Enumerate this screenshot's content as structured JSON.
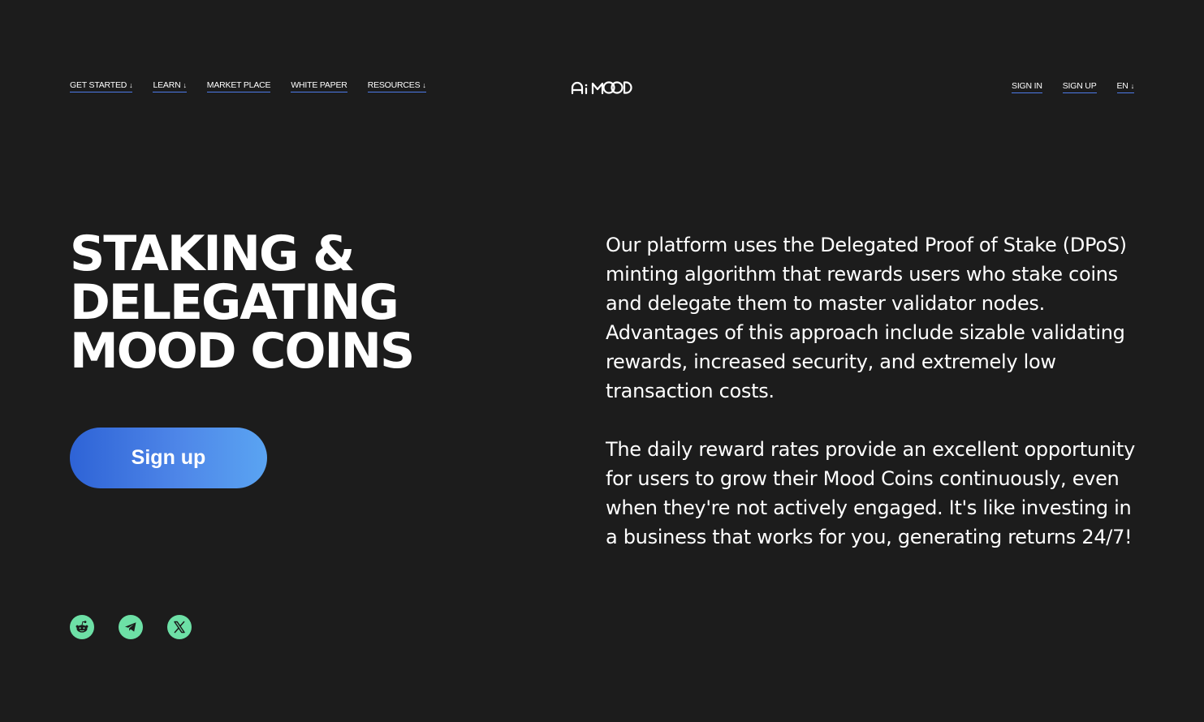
{
  "header": {
    "nav_left": [
      {
        "label": "GET STARTED",
        "dropdown": true
      },
      {
        "label": "LEARN",
        "dropdown": true
      },
      {
        "label": "MARKET PLACE",
        "dropdown": false
      },
      {
        "label": "WHITE PAPER",
        "dropdown": false
      },
      {
        "label": "RESOURCES",
        "dropdown": true
      }
    ],
    "logo_text": "Ai MOOD",
    "sign_in": "SIGN IN",
    "sign_up": "SIGN UP",
    "language": "EN",
    "dropdown_arrow": "↓"
  },
  "hero": {
    "title_lines": [
      "STAKING &",
      "DELEGATING",
      "MOOD COINS"
    ],
    "cta_label": "Sign up",
    "paragraphs": [
      "Our platform uses the Delegated Proof of Stake (DPoS) minting algorithm that rewards users who stake coins and delegate them to master validator nodes. Advantages of this approach include sizable validating rewards, increased security, and extremely low transaction costs.",
      "The daily reward rates provide an excellent opportunity for users to grow their Mood Coins continuously, even when they're not actively engaged. It's like investing in a business that works for you, generating returns 24/7!"
    ]
  },
  "socials": [
    {
      "name": "reddit-icon"
    },
    {
      "name": "telegram-icon"
    },
    {
      "name": "x-twitter-icon"
    }
  ],
  "colors": {
    "background": "#1c1c1c",
    "accent_blue": "#4d7ae8",
    "social_green": "#6de0a6",
    "text": "#ffffff"
  }
}
